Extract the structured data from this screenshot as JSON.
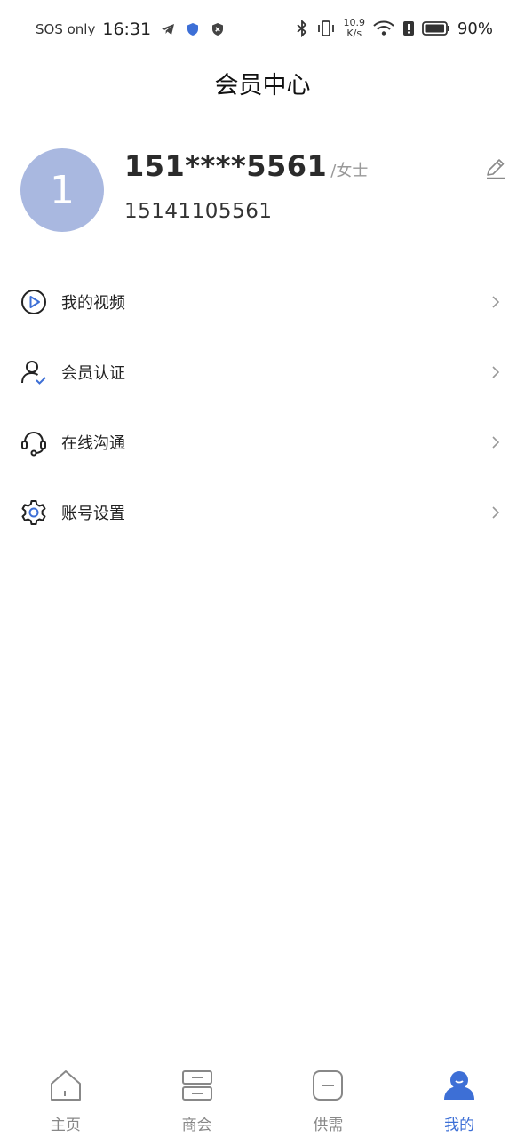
{
  "status_bar": {
    "network": "SOS only",
    "time": "16:31",
    "speed_value": "10.9",
    "speed_unit": "K/s",
    "battery": "90%"
  },
  "header": {
    "title": "会员中心"
  },
  "profile": {
    "avatar_text": "1",
    "name": "151****5561",
    "title": "/女士",
    "phone": "15141105561"
  },
  "menu": [
    {
      "label": "我的视频",
      "icon": "play-circle-icon"
    },
    {
      "label": "会员认证",
      "icon": "user-verified-icon"
    },
    {
      "label": "在线沟通",
      "icon": "headset-icon"
    },
    {
      "label": "账号设置",
      "icon": "gear-icon"
    }
  ],
  "bottom_nav": [
    {
      "label": "主页",
      "icon": "home-icon",
      "active": false
    },
    {
      "label": "商会",
      "icon": "chamber-icon",
      "active": false
    },
    {
      "label": "供需",
      "icon": "supply-demand-icon",
      "active": false
    },
    {
      "label": "我的",
      "icon": "profile-icon",
      "active": true
    }
  ],
  "colors": {
    "accent": "#3d6fd6",
    "avatar_bg": "#a9b8e0",
    "nav_inactive": "#888888"
  }
}
